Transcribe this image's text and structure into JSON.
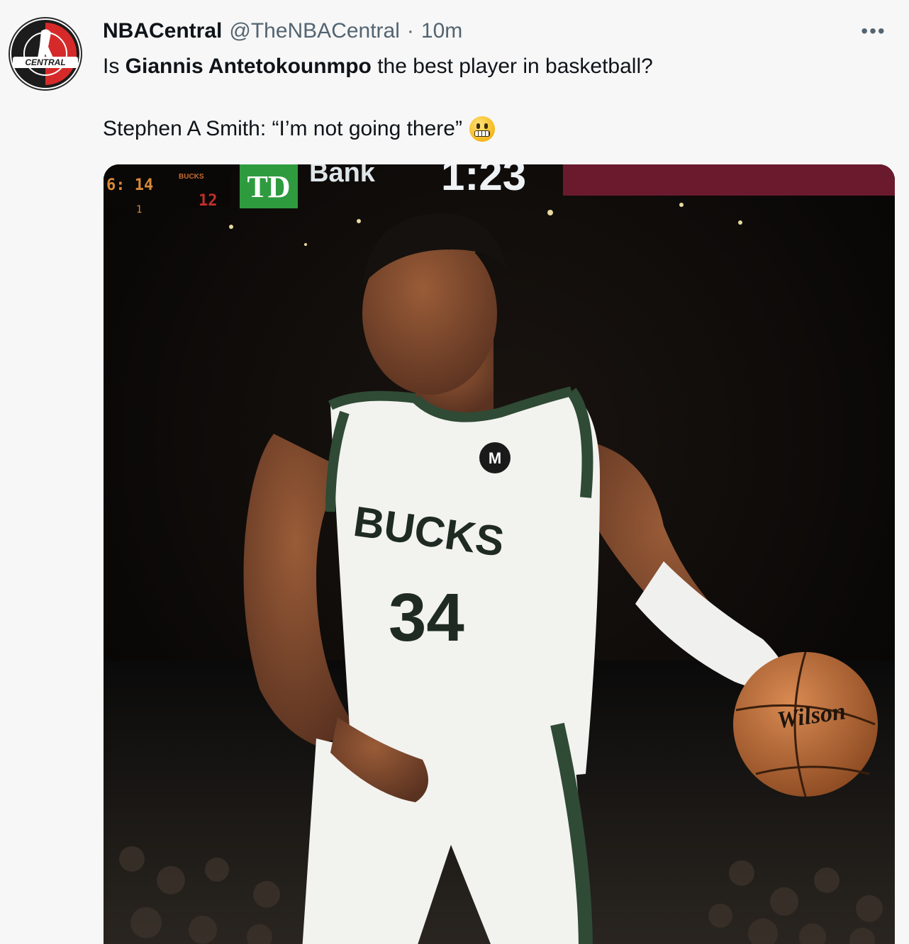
{
  "tweet": {
    "display_name": "NBACentral",
    "handle": "@TheNBACentral",
    "separator": "·",
    "time": "10m",
    "more_label": "•••",
    "avatar_logo_text": "CENTRAL",
    "text_line1_pre": "Is ",
    "text_line1_bold": "Giannis Antetokounmpo",
    "text_line1_post": " the best player in basketball?",
    "text_line2": "Stephen A Smith: “I’m not going there”",
    "emoji": "grimacing-face"
  },
  "media": {
    "description_icons": [
      "photo"
    ],
    "scoreboard": {
      "left_time": "6: 14",
      "left_sub": "1",
      "team_abbr": "BUCKS",
      "team_score": "12",
      "sponsor_logo": "TD",
      "sponsor_text": "Bank",
      "clock": "1:23"
    },
    "jersey": {
      "team": "BUCKS",
      "number": "34"
    },
    "ball_brand": "Wilson",
    "colors": {
      "jersey_white": "#f2f2ef",
      "bucks_green": "#2f4a35",
      "ball_orange": "#c2743f",
      "td_green": "#2e9b3f",
      "scoreboard_red": "#6b1a2e"
    }
  }
}
